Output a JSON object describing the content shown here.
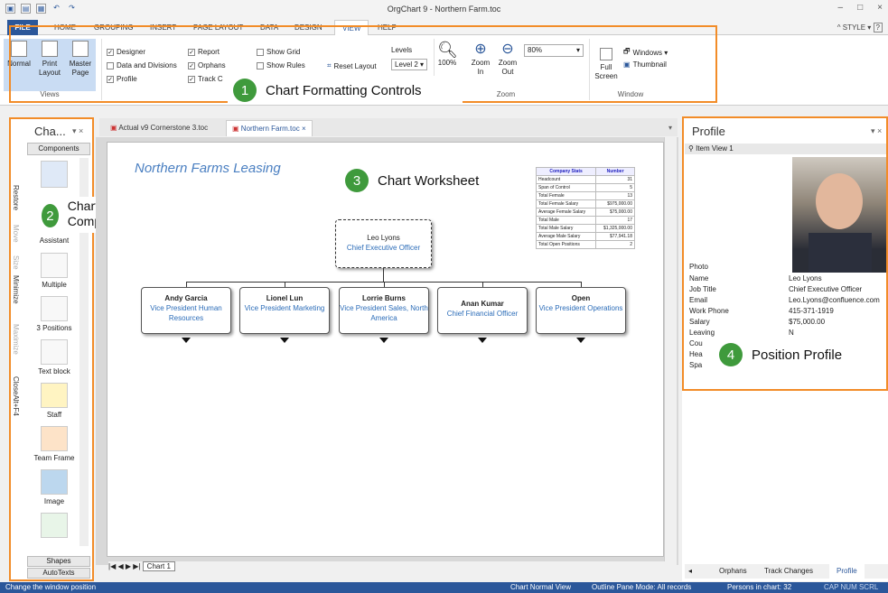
{
  "window": {
    "title": "OrgChart 9 - Northern Farm.toc",
    "controls": [
      "–",
      "□",
      "×"
    ]
  },
  "ribbon_tabs": [
    "FILE",
    "HOME",
    "GROUPING",
    "INSERT",
    "PAGE LAYOUT",
    "DATA",
    "DESIGN",
    "VIEW",
    "HELP"
  ],
  "style_label": "^ STYLE ▾",
  "help_glyph": "?",
  "ribbon": {
    "views": {
      "normal": "Normal",
      "print_layout": "Print Layout",
      "master_page": "Master Page",
      "label": "Views"
    },
    "checks": {
      "designer": "Designer",
      "data_divisions": "Data and Divisions",
      "profile": "Profile",
      "report": "Report",
      "orphans": "Orphans",
      "track": "Track C",
      "show_grid": "Show Grid",
      "show_rules": "Show Rules"
    },
    "reset_layout": "Reset Layout",
    "levels_label": "Levels",
    "levels_value": "Level 2",
    "zoom": {
      "hundred": "100%",
      "zoom_in": "Zoom In",
      "zoom_out": "Zoom Out",
      "value": "80%",
      "label": "Zoom"
    },
    "window": {
      "full_screen": "Full Screen",
      "windows": "Windows ▾",
      "thumbnail": "Thumbnail",
      "label": "Window"
    }
  },
  "callouts": {
    "c1": {
      "num": "1",
      "text": "Chart Formatting Controls"
    },
    "c2": {
      "num": "2",
      "text": "Chart Design Components"
    },
    "c3": {
      "num": "3",
      "text": "Chart Worksheet"
    },
    "c4": {
      "num": "4",
      "text": "Position Profile"
    }
  },
  "left_pane": {
    "title": "Cha...",
    "components_tab": "Components",
    "shapes_tab": "Shapes",
    "autotexts_tab": "AutoTexts",
    "vertical_menu": [
      "Restore",
      "Move",
      "Size",
      "Minimize",
      "Maximize",
      "CloseAlt+F4"
    ],
    "items": [
      "Assistant",
      "Multiple",
      "3 Positions",
      "Text block",
      "Staff",
      "Team Frame",
      "Image"
    ]
  },
  "doc_tabs": [
    "Actual v9 Cornerstone 3.toc",
    "Northern Farm.toc"
  ],
  "sheet_tab": "Chart 1",
  "chart": {
    "heading": "Northern Farms Leasing",
    "root": {
      "name": "Leo Lyons",
      "title": "Chief Executive Officer"
    },
    "children": [
      {
        "name": "Andy Garcia",
        "title": "Vice President Human Resources"
      },
      {
        "name": "Lionel Lun",
        "title": "Vice President Marketing"
      },
      {
        "name": "Lorrie Burns",
        "title": "Vice President Sales, North America"
      },
      {
        "name": "Anan Kumar",
        "title": "Chief Financial Officer"
      },
      {
        "name": "Open",
        "title": "Vice President Operations"
      }
    ],
    "stats": {
      "headers": [
        "Company Stats",
        "Number"
      ],
      "rows": [
        [
          "Headcount",
          "31"
        ],
        [
          "Span of Control",
          "5"
        ],
        [
          "Total Female",
          "13"
        ],
        [
          "Total Female Salary",
          "$975,000.00"
        ],
        [
          "Average Female Salary",
          "$75,000.00"
        ],
        [
          "Total Male",
          "17"
        ],
        [
          "Total Male Salary",
          "$1,325,000.00"
        ],
        [
          "Average Male Salary",
          "$77,941.18"
        ],
        [
          "Total Open Positions",
          "2"
        ]
      ]
    }
  },
  "profile": {
    "title": "Profile",
    "view": "Item View 1",
    "photo_label": "Photo",
    "fields": [
      [
        "Name",
        "Leo Lyons"
      ],
      [
        "Job Title",
        "Chief Executive Officer"
      ],
      [
        "Email",
        "Leo.Lyons@confluence.com"
      ],
      [
        "Work Phone",
        "415-371-1919"
      ],
      [
        "Salary",
        "$75,000.00"
      ],
      [
        "Leaving",
        "N"
      ],
      [
        "Cou",
        ""
      ],
      [
        "Hea",
        ""
      ],
      [
        "Spa",
        ""
      ]
    ],
    "bottom_tabs": [
      "Orphans",
      "Track Changes",
      "Profile"
    ]
  },
  "status": {
    "left": "Change the window position",
    "view": "Chart Normal View",
    "outline": "Outline Pane Mode: All records",
    "persons": "Persons in chart: 32",
    "keys": "CAP  NUM  SCRL"
  },
  "colors": {
    "accent": "#2b579a",
    "callout_border": "#f28c28",
    "callout_num": "#3f9a3c",
    "title_text": "#2b6cb8"
  }
}
